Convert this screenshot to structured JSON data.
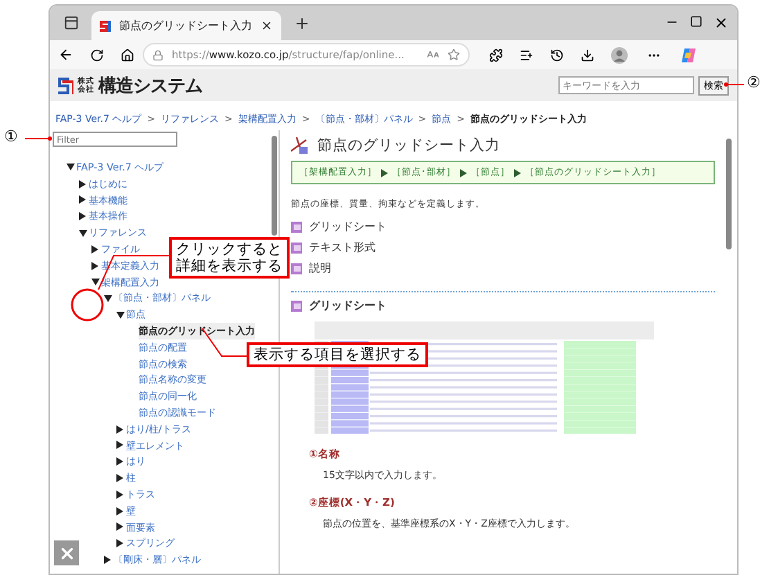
{
  "browser": {
    "tab_title": "節点のグリッドシート入力",
    "url": "https://**www.kozo.co.jp**/structure/fap/online..."
  },
  "site": {
    "logo_small": [
      "株式",
      "会社"
    ],
    "logo": "構造システム",
    "search": {
      "placeholder": "キーワードを入力"
    },
    "search_button": "検索"
  },
  "breadcrumb": [
    {
      "label": "FAP-3 Ver.7 ヘルプ",
      "link": true
    },
    {
      "separator": ">",
      "label": "リファレンス",
      "link": true
    },
    {
      "separator": ">",
      "label": "架構配置入力",
      "link": true
    },
    {
      "separator": ">",
      "label": "〔節点・部材〕パネル",
      "link": true
    },
    {
      "separator": ">",
      "label": "節点",
      "link": true
    },
    {
      "separator": ">",
      "label": "節点のグリッドシート入力",
      "link": false
    }
  ],
  "sidebar": {
    "filter": {
      "placeholder": "Filter"
    },
    "tree": [
      {
        "label": "FAP-3 Ver.7 ヘルプ",
        "expanded": true,
        "selected": false,
        "children": [
          {
            "label": "はじめに",
            "expanded": false,
            "selected": false
          },
          {
            "label": "基本機能",
            "expanded": false,
            "selected": false
          },
          {
            "label": "基本操作",
            "expanded": false,
            "selected": false
          },
          {
            "label": "リファレンス",
            "expanded": true,
            "selected": false,
            "children": [
              {
                "label": "ファイル",
                "expanded": false,
                "selected": false
              },
              {
                "label": "基本定義入力",
                "expanded": false,
                "selected": false
              },
              {
                "label": "架構配置入力",
                "expanded": true,
                "selected": false,
                "children": [
                  {
                    "label": "〔節点・部材〕パネル",
                    "expanded": true,
                    "selected": false,
                    "children": [
                      {
                        "label": "節点",
                        "expanded": true,
                        "selected": false,
                        "children": [
                          {
                            "label": "節点のグリッドシート入力",
                            "selected": true
                          },
                          {
                            "label": "節点の配置",
                            "selected": false
                          },
                          {
                            "label": "節点の検索",
                            "selected": false
                          },
                          {
                            "label": "節点名称の変更",
                            "selected": false
                          },
                          {
                            "label": "節点の同一化",
                            "selected": false
                          },
                          {
                            "label": "節点の認識モード",
                            "selected": false
                          }
                        ]
                      },
                      {
                        "label": "はり/柱/トラス",
                        "expanded": false,
                        "selected": false
                      },
                      {
                        "label": "壁エレメント",
                        "expanded": false,
                        "selected": false
                      },
                      {
                        "label": "はり",
                        "expanded": false,
                        "selected": false
                      },
                      {
                        "label": "柱",
                        "expanded": false,
                        "selected": false
                      },
                      {
                        "label": "トラス",
                        "expanded": false,
                        "selected": false
                      },
                      {
                        "label": "壁",
                        "expanded": false,
                        "selected": false
                      },
                      {
                        "label": "面要素",
                        "expanded": false,
                        "selected": false
                      },
                      {
                        "label": "スプリング",
                        "expanded": false,
                        "selected": false
                      }
                    ]
                  },
                  {
                    "label": "〔剛床・層〕パネル",
                    "expanded": false,
                    "selected": false
                  }
                ]
              }
            ]
          }
        ]
      }
    ]
  },
  "content": {
    "title": "節点のグリッドシート入力",
    "path": [
      "［架構配置入力］",
      "［節点･部材］",
      "［節点］",
      "［節点のグリッドシート入力］"
    ],
    "description": "節点の座標、質量、拘束などを定義します。",
    "toc": [
      "グリッドシート",
      "テキスト形式",
      "説明"
    ],
    "section_title": "グリッドシート",
    "fields": [
      {
        "number": "①",
        "title": "名称",
        "text": "15文字以内で入力します。"
      },
      {
        "number": "②",
        "title": "座標(X・Y・Z)",
        "text": "節点の位置を、基準座標系のX・Y・Z座標で入力します。"
      }
    ]
  },
  "annotations": {
    "markers": [
      "①",
      "②"
    ],
    "callouts": [
      [
        "クリックすると",
        "詳細を表示する"
      ],
      [
        "表示する項目を選択する"
      ]
    ]
  }
}
